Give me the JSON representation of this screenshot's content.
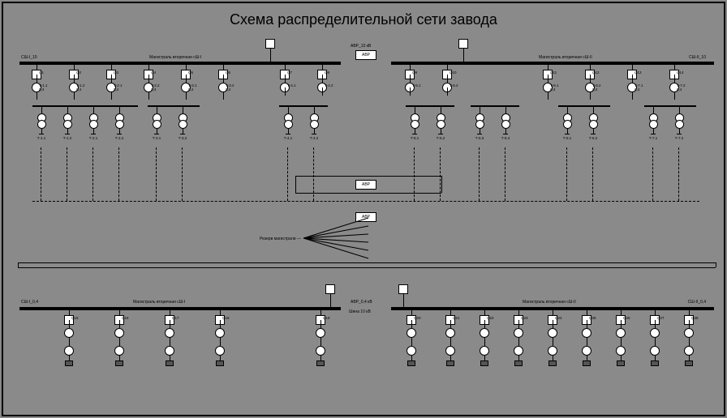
{
  "title": "Схема распределительной сети завода",
  "labels": {
    "sshA_top": "СШ-I_10",
    "sshB_top": "СШ-II_10",
    "bussectA_top": "Магистраль вторичная сШ-I",
    "bussectB_top": "Магистраль вторичная сШ-II",
    "center_top": "АВР_10 кВ",
    "avr1": "АВР",
    "avr2": "АВР",
    "avr3": "АВР",
    "reserve": "Резерв магистрали —",
    "sshA_bot": "СШ-I_0,4",
    "sshB_bot": "СШ-II_0,4",
    "bussectA_bot": "Магистраль вторичная сШ-I",
    "bussectB_bot": "Магистраль вторичная сШ-II",
    "center_bot1": "АВР_0,4 кВ",
    "shina": "Шина 10 кВ"
  },
  "top_feeders_left": [
    {
      "name": "Q1",
      "sub": [
        "Т-1.1",
        "0,4"
      ]
    },
    {
      "name": "Q2",
      "sub": [
        "Т-1.2",
        "0,4"
      ]
    },
    {
      "name": "Q3",
      "sub": [
        "Т-2.1",
        "0,4"
      ]
    },
    {
      "name": "Q4",
      "sub": [
        "Т-2.2",
        "0,4"
      ]
    },
    {
      "name": "Q5",
      "sub": [
        "Т-3.1",
        "0,4"
      ]
    },
    {
      "name": "Q6",
      "sub": [
        "Т-3.2",
        "0,4"
      ]
    }
  ],
  "top_feeders_center_left": [
    {
      "name": "Q7",
      "sub": [
        "Т-4.1"
      ]
    },
    {
      "name": "Q8",
      "sub": [
        "Т-4.2"
      ]
    }
  ],
  "top_feeders_center_right": [
    {
      "name": "Q9",
      "sub": [
        "Т-5.1"
      ]
    },
    {
      "name": "Q10",
      "sub": [
        "Т-5.2"
      ]
    }
  ],
  "top_feeders_right": [
    {
      "name": "Q11",
      "sub": [
        "Т-6.1",
        "0,4"
      ]
    },
    {
      "name": "Q12",
      "sub": [
        "Т-6.2",
        "0,4"
      ]
    },
    {
      "name": "Q13",
      "sub": [
        "Т-7.1",
        "0,4"
      ]
    },
    {
      "name": "Q14",
      "sub": [
        "Т-7.2",
        "0,4"
      ]
    }
  ],
  "top_branches_A": [
    {
      "name": "Т-1.1"
    },
    {
      "name": "Т-1.2"
    },
    {
      "name": "Т-2.1"
    },
    {
      "name": "Т-2.2"
    }
  ],
  "top_branches_B": [
    {
      "name": "Т-3.1"
    },
    {
      "name": "Т-3.2"
    }
  ],
  "mid_branches_CL": [
    {
      "name": "Т-4.1"
    },
    {
      "name": "Т-4.2"
    }
  ],
  "mid_branches_CR": [
    {
      "name": "Т-5.1"
    },
    {
      "name": "Т-5.2"
    }
  ],
  "mid_branches_CR2": [
    {
      "name": "Т-5.3"
    },
    {
      "name": "Т-5.4"
    }
  ],
  "top_branches_R": [
    {
      "name": "Т-6.1"
    },
    {
      "name": "Т-6.2"
    }
  ],
  "top_branches_R2": [
    {
      "name": "Т-7.1"
    },
    {
      "name": "Т-7.2"
    }
  ],
  "bottom_feeders_left": [
    {
      "name": "Q15"
    },
    {
      "name": "Q16"
    },
    {
      "name": "Q17"
    },
    {
      "name": "Q18"
    }
  ],
  "bottom_feeders_centerL": [
    {
      "name": "Q19"
    }
  ],
  "bottom_feeders_centerR": [
    {
      "name": "Q20"
    }
  ],
  "bottom_feeders_right": [
    {
      "name": "Q21"
    },
    {
      "name": "Q22"
    },
    {
      "name": "Q23"
    },
    {
      "name": "Q24"
    },
    {
      "name": "Q25"
    },
    {
      "name": "Q26"
    },
    {
      "name": "Q27"
    },
    {
      "name": "Q28"
    }
  ]
}
